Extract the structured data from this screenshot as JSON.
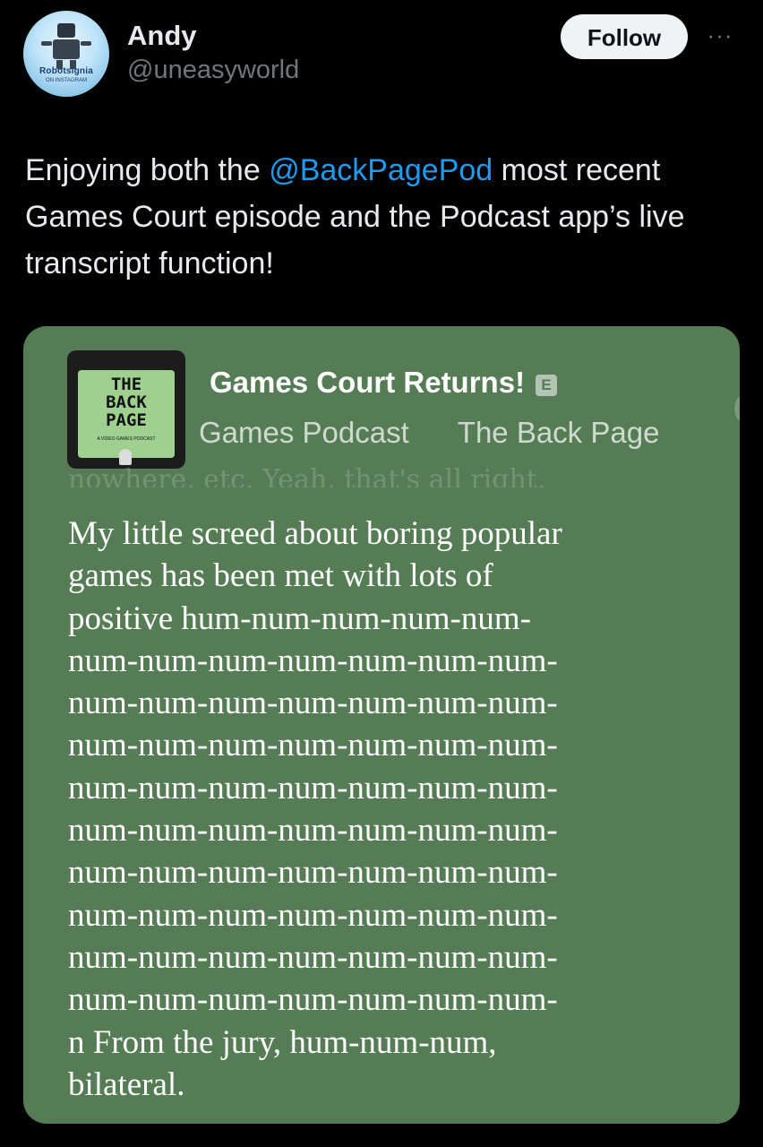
{
  "author": {
    "name": "Andy",
    "handle": "@uneasyworld",
    "avatar_text": "Robotsignia",
    "avatar_subtext": "ON INSTAGRAM"
  },
  "header": {
    "follow_label": "Follow",
    "more_icon": "ellipsis-icon",
    "more_glyph": "···"
  },
  "tweet": {
    "text_before": "Enjoying both the ",
    "mention": "@BackPagePod",
    "text_after": " most recent Games Court episode and the Podcast app’s live transcript function!"
  },
  "podcast": {
    "episode_title": "Games Court Returns!",
    "explicit_badge": "E",
    "category": "Games Podcast",
    "show_name": "The Back Page",
    "artwork_title_lines": [
      "THE",
      "BACK",
      "PAGE"
    ],
    "artwork_subtitle": "A VIDEO GAMES PODCAST",
    "faded_line": "nowhere, etc. Yeah, that's all right.",
    "transcript_lines": [
      "My little screed about boring popular",
      "games has been met with lots of",
      "positive hum-num-num-num-num-",
      "num-num-num-num-num-num-num-",
      "num-num-num-num-num-num-num-",
      "num-num-num-num-num-num-num-",
      "num-num-num-num-num-num-num-",
      "num-num-num-num-num-num-num-",
      "num-num-num-num-num-num-num-",
      "num-num-num-num-num-num-num-",
      "num-num-num-num-num-num-num-",
      "num-num-num-num-num-num-num-",
      "n From the jury, hum-num-num,",
      "bilateral."
    ]
  },
  "colors": {
    "background": "#000000",
    "mention": "#1d9bf0",
    "card_green": "#557c55",
    "follow_bg": "#eff3f4"
  }
}
